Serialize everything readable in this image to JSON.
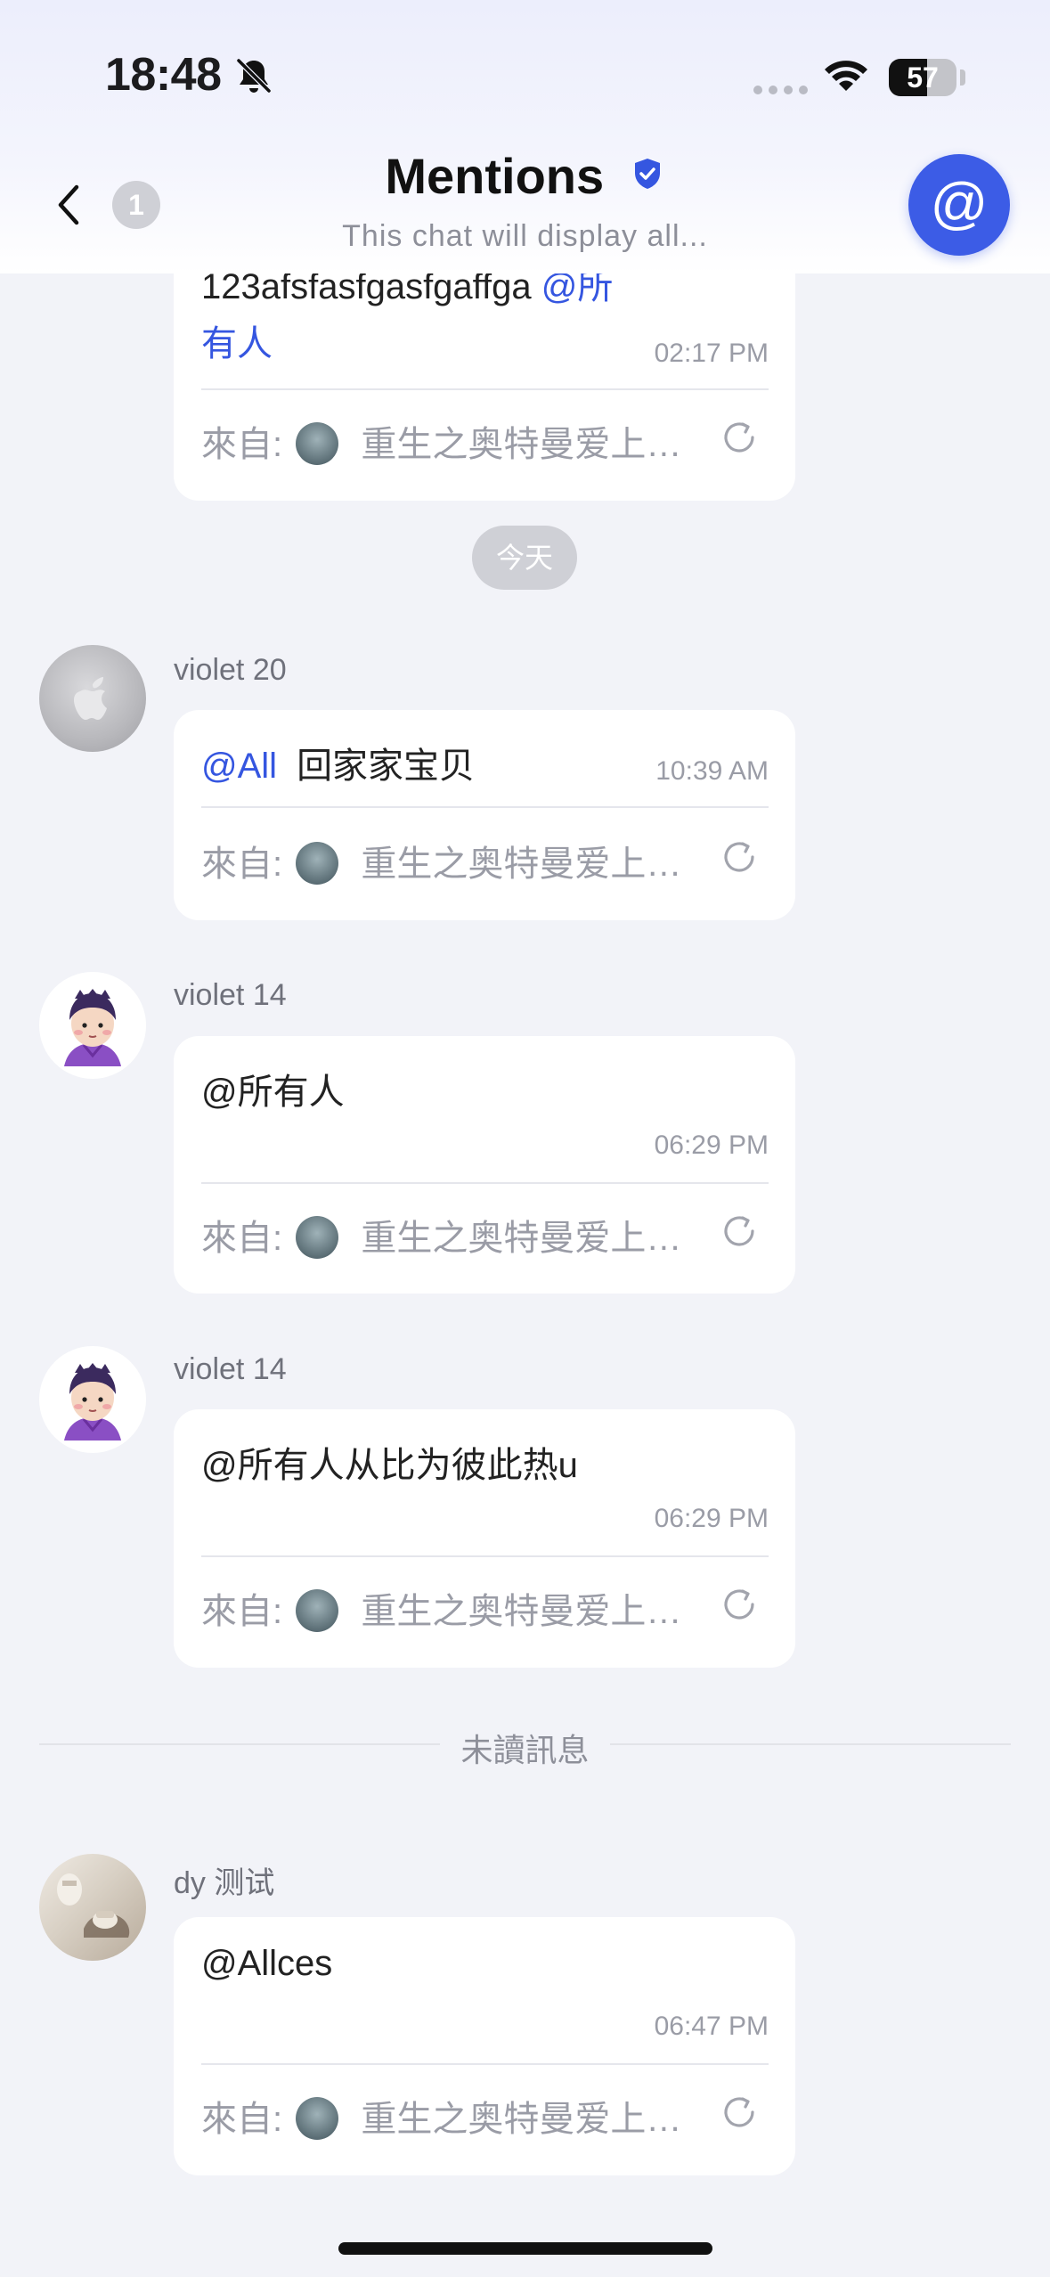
{
  "status_bar": {
    "time": "18:48",
    "battery": "57",
    "battery_level": 0.57
  },
  "header": {
    "back_badge": "1",
    "title": "Mentions",
    "subtitle": "This chat will display all...",
    "at_button": "@"
  },
  "messages_top": {
    "text_line1": "123afsfasfgasfgaffga",
    "mention_line1": "@所",
    "mention_line2": "有人",
    "time": "02:17 PM",
    "from_label": "來自:",
    "from_name": "重生之奥特曼爱上…"
  },
  "date_divider": "今天",
  "messages": [
    {
      "sender": "violet 20",
      "mention": "@All",
      "text": "回家家宝贝",
      "time": "10:39 AM",
      "from_label": "來自:",
      "from_name": "重生之奥特曼爱上…"
    },
    {
      "sender": "violet 14",
      "text": "@所有人",
      "time": "06:29 PM",
      "from_label": "來自:",
      "from_name": "重生之奥特曼爱上…"
    },
    {
      "sender": "violet 14",
      "text": "@所有人从比为彼此热u",
      "time": "06:29 PM",
      "from_label": "來自:",
      "from_name": "重生之奥特曼爱上…"
    },
    {
      "sender": "dy 测试",
      "text": "@Allces",
      "time": "06:47 PM",
      "from_label": "來自:",
      "from_name": "重生之奥特曼爱上…"
    }
  ],
  "unread_divider": "未讀訊息",
  "icons": [
    "bell-slash-icon",
    "wifi-icon",
    "battery-icon",
    "back-chevron-icon",
    "verified-shield-icon",
    "at-icon",
    "forward-icon"
  ],
  "colors": {
    "accent": "#3c5ce6",
    "mention": "#3556e0",
    "background": "#f2f3f8"
  }
}
